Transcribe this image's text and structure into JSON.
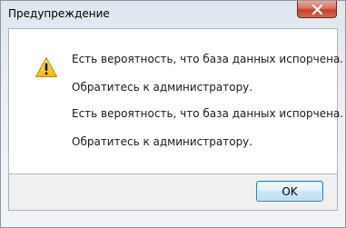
{
  "window": {
    "title": "Предупреждение"
  },
  "message": {
    "lines": [
      "Есть вероятность, что база данных испорчена.",
      "Обратитесь к администратору.",
      "Есть вероятность, что база данных испорчена.",
      "Обратитесь к администратору."
    ],
    "icon": "warning-icon"
  },
  "buttons": {
    "ok_label": "OK"
  },
  "colors": {
    "warning_yellow": "#f5c518",
    "close_button_red": "#c5402a",
    "ok_border": "#3c7fb1"
  }
}
